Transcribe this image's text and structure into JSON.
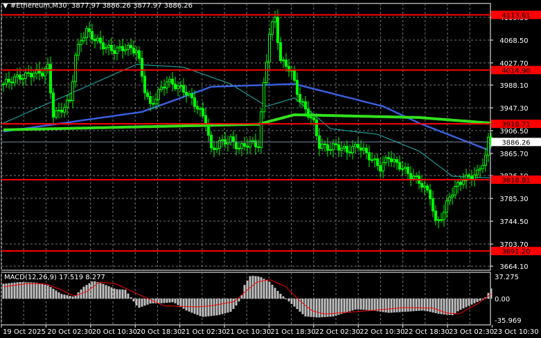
{
  "header": {
    "symbol": "#Ethereum,M30",
    "open": "3877.97",
    "high": "3886.26",
    "low": "3877.97",
    "close": "3886.26"
  },
  "price_axis": {
    "ticks": [
      "4109.30",
      "4068.50",
      "4027.70",
      "3988.10",
      "3947.30",
      "3906.50",
      "3865.70",
      "3826.10",
      "3785.30",
      "3744.50",
      "3703.70",
      "3664.10"
    ],
    "current_price": "3886.26"
  },
  "levels": [
    {
      "price": "4113.61",
      "color": "#ff0000"
    },
    {
      "price": "4014.90",
      "color": "#ff0000"
    },
    {
      "price": "3918.71",
      "color": "#ff0000"
    },
    {
      "price": "3818.81",
      "color": "#ff0000"
    },
    {
      "price": "3691.20",
      "color": "#ff0000"
    }
  ],
  "macd": {
    "label": "MACD(12,26,9) 17.519 8.277",
    "ticks": [
      "37.275",
      "0.00",
      "-35.969"
    ]
  },
  "time_axis": [
    "19 Oct 2025",
    "20 Oct 02:30",
    "20 Oct 10:30",
    "20 Oct 18:30",
    "21 Oct 02:30",
    "21 Oct 10:30",
    "21 Oct 18:30",
    "22 Oct 02:30",
    "22 Oct 10:30",
    "22 Oct 18:30",
    "23 Oct 02:30",
    "23 Oct 10:30"
  ],
  "colors": {
    "candle": "#00ff00",
    "ma_fast": "#1f9e9e",
    "ma_mid": "#3a5fe0",
    "ma_slow": "#32e01e",
    "level": "#ff0000",
    "signal": "#ff0000",
    "histogram": "#c0c0c0"
  },
  "chart_data": {
    "type": "candlestick",
    "price_keypoints": [
      [
        0,
        3990
      ],
      [
        4,
        4000
      ],
      [
        8,
        4005
      ],
      [
        11,
        4010
      ],
      [
        14,
        4010
      ],
      [
        16,
        4020
      ],
      [
        18,
        3935
      ],
      [
        20,
        3940
      ],
      [
        24,
        3960
      ],
      [
        26,
        4040
      ],
      [
        28,
        4070
      ],
      [
        30,
        4085
      ],
      [
        33,
        4070
      ],
      [
        37,
        4055
      ],
      [
        40,
        4050
      ],
      [
        44,
        4055
      ],
      [
        48,
        4050
      ],
      [
        49,
        4030
      ],
      [
        51,
        3980
      ],
      [
        53,
        3950
      ],
      [
        56,
        3975
      ],
      [
        59,
        3995
      ],
      [
        63,
        3985
      ],
      [
        66,
        3975
      ],
      [
        69,
        3955
      ],
      [
        73,
        3925
      ],
      [
        75,
        3870
      ],
      [
        78,
        3885
      ],
      [
        82,
        3890
      ],
      [
        85,
        3875
      ],
      [
        89,
        3885
      ],
      [
        92,
        3880
      ],
      [
        94,
        3990
      ],
      [
        96,
        4080
      ],
      [
        98,
        4110
      ],
      [
        100,
        4030
      ],
      [
        102,
        4025
      ],
      [
        104,
        4010
      ],
      [
        107,
        3960
      ],
      [
        109,
        3945
      ],
      [
        112,
        3920
      ],
      [
        114,
        3880
      ],
      [
        118,
        3875
      ],
      [
        120,
        3880
      ],
      [
        124,
        3870
      ],
      [
        128,
        3880
      ],
      [
        130,
        3870
      ],
      [
        134,
        3850
      ],
      [
        136,
        3840
      ],
      [
        139,
        3860
      ],
      [
        141,
        3850
      ],
      [
        144,
        3840
      ],
      [
        146,
        3830
      ],
      [
        149,
        3820
      ],
      [
        151,
        3810
      ],
      [
        154,
        3790
      ],
      [
        156,
        3740
      ],
      [
        159,
        3760
      ],
      [
        161,
        3790
      ],
      [
        164,
        3810
      ],
      [
        166,
        3820
      ],
      [
        169,
        3825
      ],
      [
        171,
        3830
      ],
      [
        174,
        3860
      ],
      [
        175,
        3890
      ],
      [
        176,
        3886
      ]
    ],
    "ma_fast": [
      [
        0,
        3920
      ],
      [
        48,
        4025
      ],
      [
        65,
        4020
      ],
      [
        82,
        3990
      ],
      [
        95,
        3950
      ],
      [
        105,
        3965
      ],
      [
        118,
        3910
      ],
      [
        135,
        3900
      ],
      [
        150,
        3870
      ],
      [
        162,
        3825
      ],
      [
        176,
        3822
      ]
    ],
    "ma_mid": [
      [
        0,
        3905
      ],
      [
        50,
        3940
      ],
      [
        75,
        3985
      ],
      [
        105,
        3990
      ],
      [
        137,
        3950
      ],
      [
        150,
        3920
      ],
      [
        176,
        3870
      ]
    ],
    "ma_slow": [
      [
        0,
        3908
      ],
      [
        92,
        3918
      ],
      [
        105,
        3935
      ],
      [
        150,
        3930
      ],
      [
        176,
        3920
      ]
    ],
    "macd_hist": [
      [
        0,
        25
      ],
      [
        10,
        28
      ],
      [
        20,
        27
      ],
      [
        28,
        22
      ],
      [
        36,
        8
      ],
      [
        44,
        3
      ],
      [
        50,
        20
      ],
      [
        56,
        30
      ],
      [
        62,
        25
      ],
      [
        70,
        16
      ],
      [
        76,
        15
      ],
      [
        80,
        0
      ],
      [
        84,
        -16
      ],
      [
        92,
        -8
      ],
      [
        98,
        -8
      ],
      [
        106,
        -6
      ],
      [
        114,
        -20
      ],
      [
        124,
        -31
      ],
      [
        134,
        -28
      ],
      [
        142,
        -22
      ],
      [
        145,
        -12
      ],
      [
        148,
        0
      ],
      [
        150,
        22
      ],
      [
        154,
        39
      ],
      [
        160,
        37
      ],
      [
        166,
        28
      ],
      [
        172,
        10
      ],
      [
        180,
        -10
      ],
      [
        188,
        -30
      ],
      [
        196,
        -32
      ],
      [
        206,
        -30
      ],
      [
        220,
        -18
      ],
      [
        230,
        -20
      ],
      [
        240,
        -24
      ],
      [
        252,
        -22
      ],
      [
        262,
        -20
      ],
      [
        272,
        -26
      ],
      [
        280,
        -28
      ],
      [
        284,
        -20
      ],
      [
        292,
        -10
      ],
      [
        300,
        0
      ],
      [
        304,
        17
      ]
    ],
    "macd_signal": [
      [
        0,
        20
      ],
      [
        14,
        25
      ],
      [
        26,
        25
      ],
      [
        36,
        15
      ],
      [
        44,
        4
      ],
      [
        52,
        12
      ],
      [
        60,
        28
      ],
      [
        70,
        25
      ],
      [
        82,
        10
      ],
      [
        100,
        -12
      ],
      [
        120,
        -14
      ],
      [
        130,
        -12
      ],
      [
        144,
        -5
      ],
      [
        150,
        10
      ],
      [
        158,
        28
      ],
      [
        166,
        32
      ],
      [
        176,
        20
      ],
      [
        184,
        -2
      ],
      [
        192,
        -20
      ],
      [
        200,
        -26
      ],
      [
        230,
        -20
      ],
      [
        250,
        -15
      ],
      [
        268,
        -16
      ],
      [
        276,
        -24
      ],
      [
        284,
        -26
      ],
      [
        296,
        -8
      ],
      [
        304,
        8
      ]
    ]
  }
}
